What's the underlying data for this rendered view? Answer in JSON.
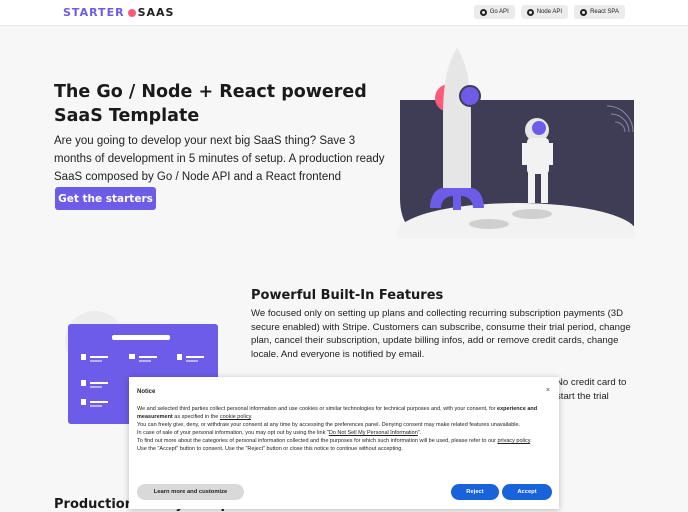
{
  "header": {
    "logo_part1": "STARTER",
    "logo_part2": "SAAS",
    "nav": [
      {
        "label": "Go API",
        "icon": "github-icon"
      },
      {
        "label": "Node API",
        "icon": "github-icon"
      },
      {
        "label": "React SPA",
        "icon": "github-icon"
      }
    ]
  },
  "hero": {
    "title": "The Go / Node + React powered SaaS Template",
    "description": "Are you going to develop your next big SaaS thing? Save 3 months of development in 5 minutes of setup. A production ready SaaS composed by Go / Node API and a React frontend",
    "cta_label": "Get the starters"
  },
  "features": {
    "title": "Powerful Built-In Features",
    "description": "We focused only on setting up plans and collecting recurring subscription payments (3D secure enabled) with Stripe. Customers can subscribe, consume their trial period, change plan, cancel their subscription, update billing infos, add or remove credit cards, change locale. And everyone is notified by email.",
    "description_partial": "No credit card to start the trial"
  },
  "production": {
    "title": "Production Ready Components"
  },
  "notice": {
    "title": "Notice",
    "close_glyph": "×",
    "line1_a": "We and selected third parties collect personal information and use cookies or similar technologies for technical purposes and, with your consent, for ",
    "line1_b": "experience and measurement",
    "line1_c": " as specified in the ",
    "cookie_policy_link": "cookie policy",
    "line1_d": ".",
    "line2": "You can freely give, deny, or withdraw your consent at any time by accessing the preferences panel. Denying consent may make related features unavailable.",
    "line3_a": "In case of sale of your personal information, you may opt out by using the link \"",
    "dnsmpi_link": "Do Not Sell My Personal Information",
    "line3_b": "\".",
    "line4_a": "To find out more about the categories of personal information collected and the purposes for which such information will be used, please refer to our ",
    "privacy_policy_link": "privacy policy",
    "line4_b": ".",
    "line5": "Use the \"Accept\" button to consent. Use the \"Reject\" button or close this notice to continue without accepting.",
    "learn_more_label": "Learn more and customize",
    "reject_label": "Reject",
    "accept_label": "Accept"
  },
  "colors": {
    "brand": "#6c5ce7",
    "accent_pink": "#ff5a7a",
    "consent_blue": "#1863dc",
    "illustration_navy": "#3f3d56"
  }
}
